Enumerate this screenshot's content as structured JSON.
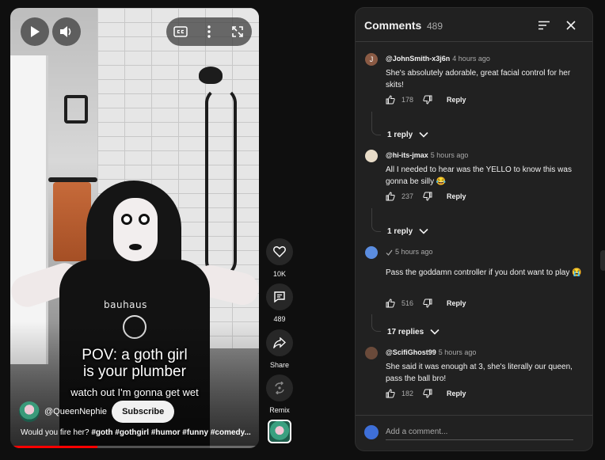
{
  "player": {
    "caption_line1": "POV: a goth girl",
    "caption_line2": "is your plumber",
    "caption_line3": "watch out I'm gonna get wet",
    "shirt_text": "bauhaus",
    "channel_name": "@QueenNephie",
    "subscribe_label": "Subscribe",
    "description_prefix": "Would you fire her? ",
    "description_tags": "#goth #gothgirl #humor #funny #comedy...",
    "progress_fraction": 0.35,
    "icons": [
      "play-icon",
      "volume-icon",
      "cc-icon",
      "more-vert-icon",
      "fullscreen-icon"
    ]
  },
  "actions": {
    "like_label": "10K",
    "comments_label": "489",
    "share_label": "Share",
    "remix_label": "Remix"
  },
  "comments_panel": {
    "title": "Comments",
    "count": "489",
    "placeholder": "Add a comment...",
    "comments": [
      {
        "author": "@JohnSmith-x3j6n",
        "time": "4 hours ago",
        "text": "She's absolutely adorable, great facial control for her skits!",
        "likes": "178",
        "reply_label": "Reply",
        "replies_label": "1 reply",
        "avatar_letter": "J",
        "avatar_color": "#8a5a44"
      },
      {
        "author": "@hi-its-jmax",
        "time": "5 hours ago",
        "text": "All I needed to hear was the YELLO to know this was gonna be silly 😂",
        "likes": "237",
        "reply_label": "Reply",
        "replies_label": "1 reply",
        "avatar_color": "#e8dcc8"
      },
      {
        "author": "",
        "time": "5 hours ago",
        "text": "Pass the goddamn controller if you dont want to play 😭",
        "likes": "516",
        "reply_label": "Reply",
        "replies_label": "17 replies",
        "avatar_color": "#5b8de0"
      },
      {
        "author": "@ScifiGhost99",
        "time": "5 hours ago",
        "text": "She said it was enough at 3, she's literally our queen, pass the ball bro!",
        "likes": "182",
        "reply_label": "Reply",
        "avatar_color": "#6a4a3a"
      }
    ]
  }
}
